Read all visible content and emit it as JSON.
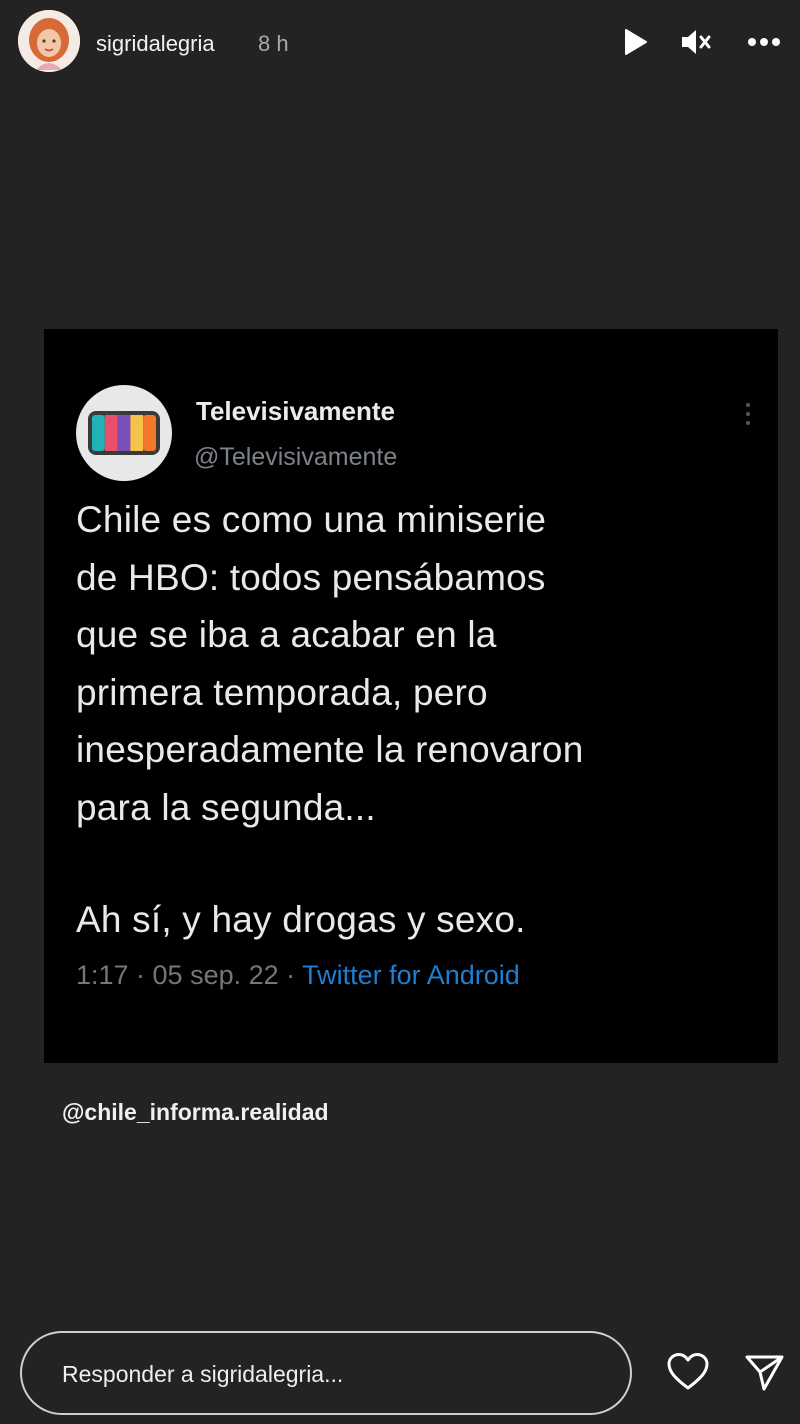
{
  "header": {
    "username": "sigridalegria",
    "time": "8 h",
    "icons": [
      "avatar",
      "play-icon",
      "mute-icon",
      "more-icon"
    ]
  },
  "tweet": {
    "display_name": "Televisivamente",
    "handle": "@Televisivamente",
    "body_lines": [
      "Chile es como una miniserie",
      "de HBO: todos pensábamos",
      "que se iba a acabar en la",
      "primera temporada, pero",
      "inesperadamente la renovaron",
      "para la segunda..."
    ],
    "extra_line": "Ah sí, y hay drogas y sexo.",
    "meta_time": "1:17 · 05 sep. 22 · ",
    "meta_source": "Twitter for Android",
    "avatar_colors": [
      "#1fb3b8",
      "#e94f6b",
      "#7a4fb8",
      "#f6c24a",
      "#f2792b"
    ],
    "source_color": "#1d7fd2"
  },
  "mention": "@chile_informa.realidad",
  "reply": {
    "placeholder": "Responder a sigridalegria..."
  },
  "bottom_icons": [
    "heart-icon",
    "send-icon"
  ]
}
